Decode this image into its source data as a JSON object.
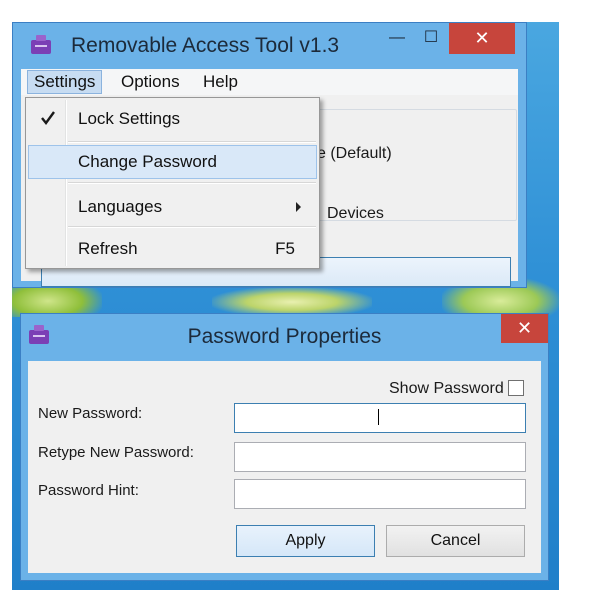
{
  "main_window": {
    "title": "Removable Access Tool v1.3",
    "icon": "usb-drive-icon",
    "controls": {
      "minimize": "—",
      "maximize": "☐",
      "close": "✕"
    },
    "menu": {
      "settings": "Settings",
      "options": "Options",
      "help": "Help"
    },
    "partial_texts": [
      "e (Default)",
      "Devices"
    ]
  },
  "settings_menu": {
    "items": [
      {
        "label": "Lock Settings",
        "checked": true
      },
      {
        "label": "Change Password",
        "highlighted": true
      },
      {
        "label": "Languages",
        "submenu": true
      },
      {
        "label": "Refresh",
        "shortcut": "F5"
      }
    ]
  },
  "password_dialog": {
    "title": "Password Properties",
    "icon": "usb-drive-icon",
    "close": "✕",
    "show_password_label": "Show Password",
    "show_password_checked": false,
    "fields": {
      "new_password": {
        "label": "New Password:",
        "value": ""
      },
      "retype_password": {
        "label": "Retype New Password:",
        "value": ""
      },
      "password_hint": {
        "label": "Password Hint:",
        "value": ""
      }
    },
    "buttons": {
      "apply": "Apply",
      "cancel": "Cancel"
    }
  },
  "colors": {
    "title_bar": "#6bb2e8",
    "close_button": "#c7453c",
    "menu_highlight": "#d9e8f8",
    "focus_border": "#3c7fb1"
  }
}
